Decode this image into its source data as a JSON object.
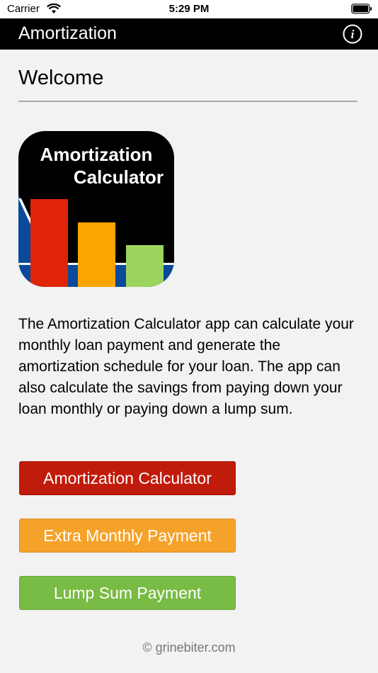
{
  "status_bar": {
    "carrier": "Carrier",
    "time": "5:29 PM",
    "icons": [
      "wifi-icon",
      "battery-icon"
    ]
  },
  "nav": {
    "title": "Amortization",
    "info_icon": "info-icon",
    "info_glyph": "i"
  },
  "page": {
    "heading": "Welcome",
    "logo": {
      "line1": "Amortization",
      "line2": "Calculator",
      "bar_colors": [
        "#e02408",
        "#fca500",
        "#9cd55e"
      ],
      "background": "#000000",
      "stripe_color": "#0a4a9b"
    },
    "intro": "The Amortization Calculator app can calculate your monthly loan payment and generate the amortization schedule for your loan. The app can also calculate the savings from paying down your loan monthly or paying down a lump sum."
  },
  "buttons": [
    {
      "label": "Amortization Calculator",
      "color": "#c11b0b"
    },
    {
      "label": "Extra Monthly Payment",
      "color": "#f5a22a"
    },
    {
      "label": "Lump Sum Payment",
      "color": "#78bb45"
    }
  ],
  "footer": {
    "text": "© grinebiter.com"
  }
}
